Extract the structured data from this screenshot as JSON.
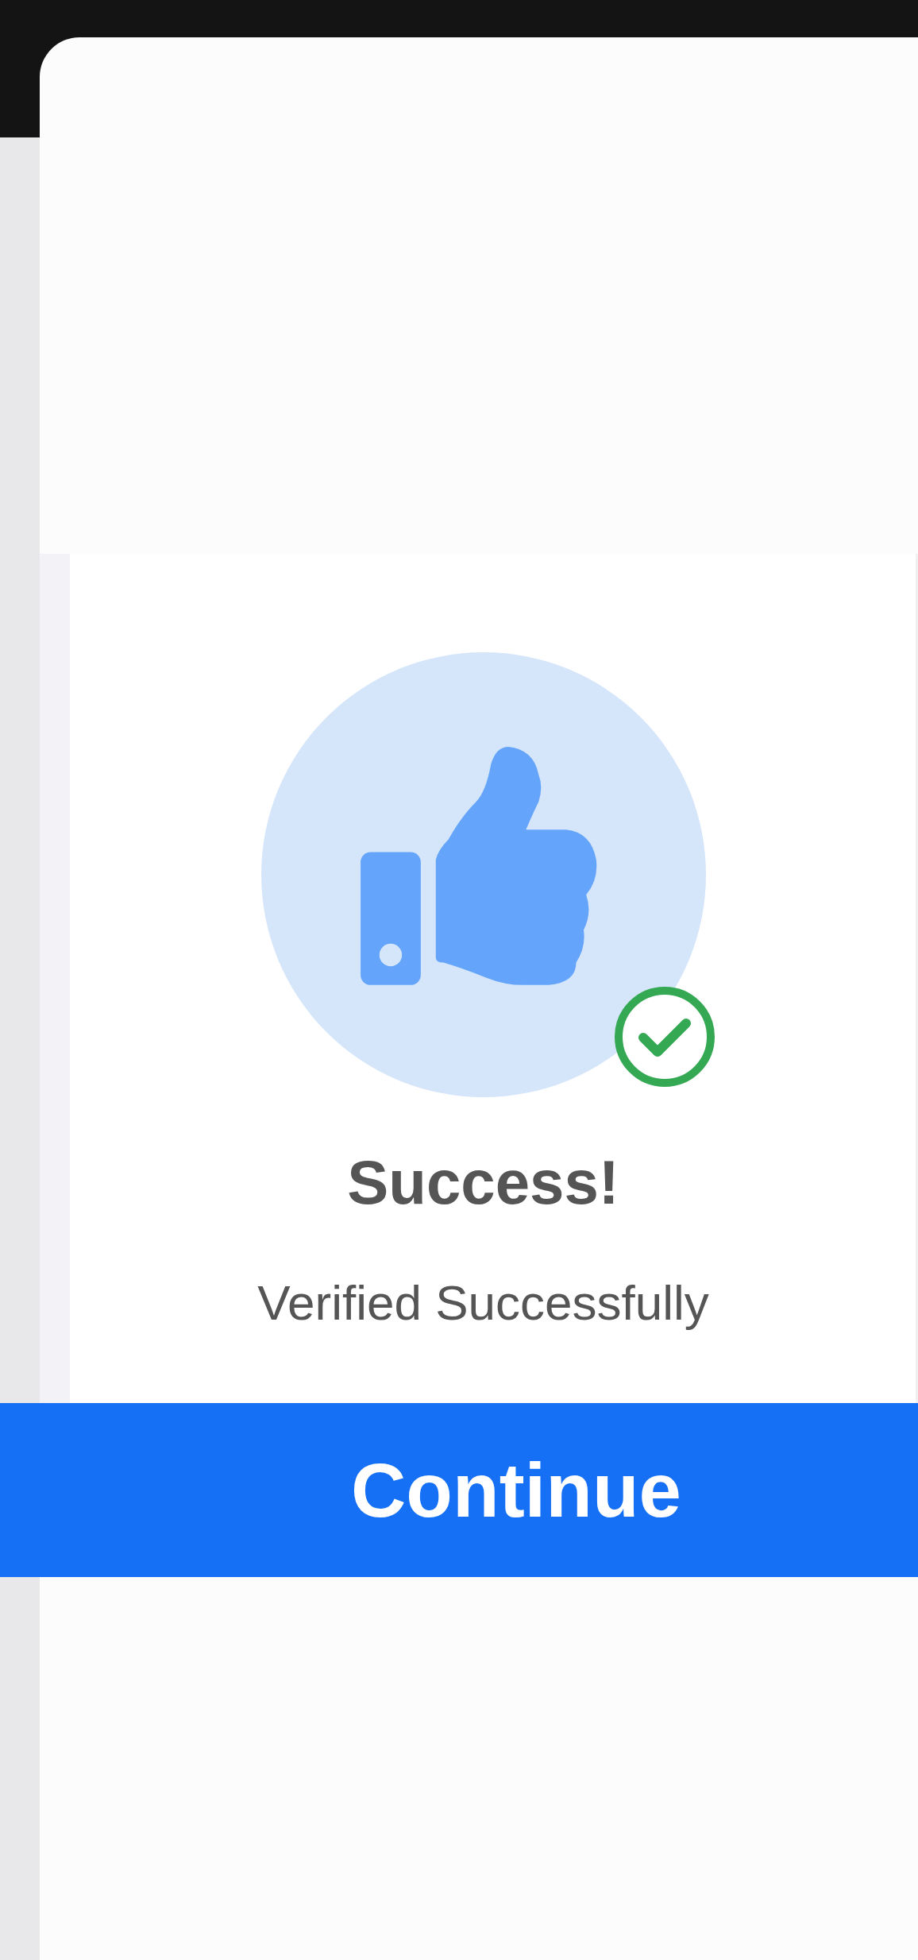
{
  "title": "Success!",
  "message": "Verified Successfully",
  "button": "Continue"
}
